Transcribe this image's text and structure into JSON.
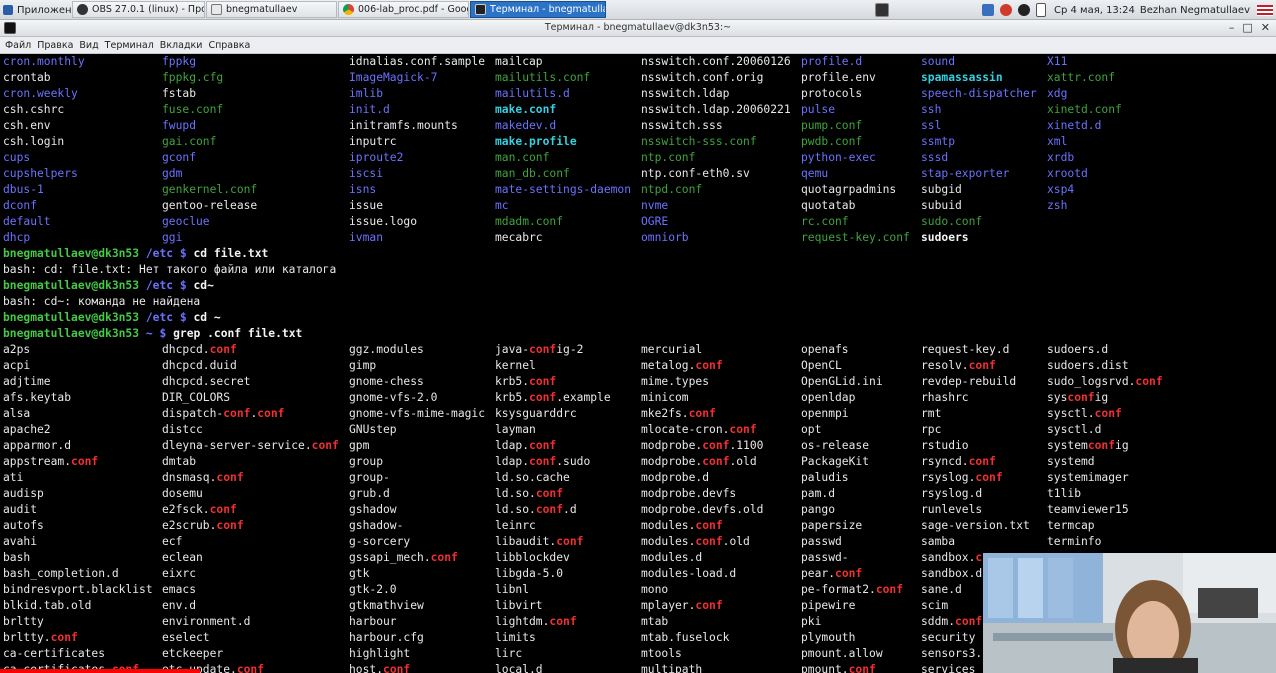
{
  "taskbar": {
    "apps_label": "Приложения",
    "tasks": [
      {
        "label": "OBS 27.0.1 (linux) - Проф..."
      },
      {
        "label": "bnegmatullaev"
      },
      {
        "label": "006-lab_proc.pdf - Google..."
      },
      {
        "label": "Терминал - bnegmatullaev..."
      }
    ],
    "clock": "Ср 4 мая, 13:24",
    "user": "Bezhan Negmatullaev"
  },
  "window": {
    "title": "Терминал - bnegmatullaev@dk3n53:~"
  },
  "menu": [
    "Файл",
    "Правка",
    "Вид",
    "Терминал",
    "Вкладки",
    "Справка"
  ],
  "colors": {
    "dir_blue": "#6b72ff",
    "exec_green": "#3fa43c",
    "prompt_green": "#45c945",
    "match_red": "#ef3030",
    "link_cyan": "#35d0e0"
  },
  "terminal": {
    "top_rows": [
      [
        [
          "cron.monthly",
          "blue"
        ],
        [
          "fppkg",
          "blue"
        ],
        [
          "idnalias.conf.sample",
          ""
        ],
        [
          "mailcap",
          ""
        ],
        [
          "nsswitch.conf.20060126",
          ""
        ],
        [
          "profile.d",
          "blue"
        ],
        [
          "sound",
          "blue"
        ],
        [
          "X11",
          "blue"
        ]
      ],
      [
        [
          "crontab",
          ""
        ],
        [
          "fppkg.cfg",
          "green"
        ],
        [
          "ImageMagick-7",
          "blue"
        ],
        [
          "mailutils.conf",
          "green"
        ],
        [
          "nsswitch.conf.orig",
          ""
        ],
        [
          "profile.env",
          ""
        ],
        [
          "spamassassin",
          "cyan"
        ],
        [
          "xattr.conf",
          "green"
        ]
      ],
      [
        [
          "cron.weekly",
          "blue"
        ],
        [
          "fstab",
          ""
        ],
        [
          "imlib",
          "blue"
        ],
        [
          "mailutils.d",
          "blue"
        ],
        [
          "nsswitch.ldap",
          ""
        ],
        [
          "protocols",
          ""
        ],
        [
          "speech-dispatcher",
          "blue"
        ],
        [
          "xdg",
          "blue"
        ]
      ],
      [
        [
          "csh.cshrc",
          ""
        ],
        [
          "fuse.conf",
          "green"
        ],
        [
          "init.d",
          "blue"
        ],
        [
          "make.conf",
          "cyan"
        ],
        [
          "nsswitch.ldap.20060221",
          ""
        ],
        [
          "pulse",
          "blue"
        ],
        [
          "ssh",
          "blue"
        ],
        [
          "xinetd.conf",
          "green"
        ]
      ],
      [
        [
          "csh.env",
          ""
        ],
        [
          "fwupd",
          "blue"
        ],
        [
          "initramfs.mounts",
          ""
        ],
        [
          "makedev.d",
          "blue"
        ],
        [
          "nsswitch.sss",
          ""
        ],
        [
          "pump.conf",
          "green"
        ],
        [
          "ssl",
          "blue"
        ],
        [
          "xinetd.d",
          "blue"
        ]
      ],
      [
        [
          "csh.login",
          ""
        ],
        [
          "gai.conf",
          "green"
        ],
        [
          "inputrc",
          ""
        ],
        [
          "make.profile",
          "cyan"
        ],
        [
          "nsswitch-sss.conf",
          "green"
        ],
        [
          "pwdb.conf",
          "green"
        ],
        [
          "ssmtp",
          "blue"
        ],
        [
          "xml",
          "blue"
        ]
      ],
      [
        [
          "cups",
          "blue"
        ],
        [
          "gconf",
          "blue"
        ],
        [
          "iproute2",
          "blue"
        ],
        [
          "man.conf",
          "green"
        ],
        [
          "ntp.conf",
          "green"
        ],
        [
          "python-exec",
          "blue"
        ],
        [
          "sssd",
          "blue"
        ],
        [
          "xrdb",
          "blue"
        ]
      ],
      [
        [
          "cupshelpers",
          "blue"
        ],
        [
          "gdm",
          "blue"
        ],
        [
          "iscsi",
          "blue"
        ],
        [
          "man_db.conf",
          "green"
        ],
        [
          "ntp.conf-eth0.sv",
          ""
        ],
        [
          "qemu",
          "blue"
        ],
        [
          "stap-exporter",
          "blue"
        ],
        [
          "xrootd",
          "blue"
        ]
      ],
      [
        [
          "dbus-1",
          "blue"
        ],
        [
          "genkernel.conf",
          "green"
        ],
        [
          "isns",
          "blue"
        ],
        [
          "mate-settings-daemon",
          "blue"
        ],
        [
          "ntpd.conf",
          "green"
        ],
        [
          "quotagrpadmins",
          ""
        ],
        [
          "subgid",
          ""
        ],
        [
          "xsp4",
          "blue"
        ]
      ],
      [
        [
          "dconf",
          "blue"
        ],
        [
          "gentoo-release",
          ""
        ],
        [
          "issue",
          ""
        ],
        [
          "mc",
          "blue"
        ],
        [
          "nvme",
          "blue"
        ],
        [
          "quotatab",
          ""
        ],
        [
          "subuid",
          ""
        ],
        [
          "zsh",
          "blue"
        ]
      ],
      [
        [
          "default",
          "blue"
        ],
        [
          "geoclue",
          "blue"
        ],
        [
          "issue.logo",
          ""
        ],
        [
          "mdadm.conf",
          "green"
        ],
        [
          "OGRE",
          "blue"
        ],
        [
          "rc.conf",
          "green"
        ],
        [
          "sudo.conf",
          "green"
        ],
        [
          "",
          ""
        ]
      ],
      [
        [
          "dhcp",
          "blue"
        ],
        [
          "ggi",
          "blue"
        ],
        [
          "ivman",
          "blue"
        ],
        [
          "mecabrc",
          ""
        ],
        [
          "omniorb",
          "blue"
        ],
        [
          "request-key.conf",
          "green"
        ],
        [
          "sudoers",
          "bold"
        ],
        [
          "",
          ""
        ]
      ]
    ],
    "session": [
      {
        "user": "bnegmatullaev@dk3n53",
        "path": "/etc",
        "cmd": "cd file.txt"
      },
      {
        "out": "bash: cd: file.txt: Нет такого файла или каталога"
      },
      {
        "user": "bnegmatullaev@dk3n53",
        "path": "/etc",
        "cmd": "cd~"
      },
      {
        "out": "bash: cd~: команда не найдена"
      },
      {
        "user": "bnegmatullaev@dk3n53",
        "path": "/etc",
        "cmd": "cd ~"
      },
      {
        "user": "bnegmatullaev@dk3n53",
        "path": "~",
        "cmd": "grep .conf file.txt"
      }
    ],
    "prompt_symbol": "$",
    "grep_rows": [
      [
        "a2ps",
        "dhcpcd.|conf|",
        "ggz.modules",
        "java-|conf|ig-2",
        "mercurial",
        "openafs",
        "request-key.d",
        "sudoers.d"
      ],
      [
        "acpi",
        "dhcpcd.duid",
        "gimp",
        "kernel",
        "metalog.|conf|",
        "OpenCL",
        "resolv.|conf|",
        "sudoers.dist"
      ],
      [
        "adjtime",
        "dhcpcd.secret",
        "gnome-chess",
        "krb5.|conf|",
        "mime.types",
        "OpenGLid.ini",
        "revdep-rebuild",
        "sudo_logsrvd.|conf|"
      ],
      [
        "afs.keytab",
        "DIR_COLORS",
        "gnome-vfs-2.0",
        "krb5.|conf|.example",
        "minicom",
        "openldap",
        "rhashrc",
        "sys|conf|ig"
      ],
      [
        "alsa",
        "dispatch-|conf|.|conf|",
        "gnome-vfs-mime-magic",
        "ksysguarddrc",
        "mke2fs.|conf|",
        "openmpi",
        "rmt",
        "sysctl.|conf|"
      ],
      [
        "apache2",
        "distcc",
        "GNUstep",
        "layman",
        "mlocate-cron.|conf|",
        "opt",
        "rpc",
        "sysctl.d"
      ],
      [
        "apparmor.d",
        "dleyna-server-service.|conf|",
        "gpm",
        "ldap.|conf|",
        "modprobe.|conf|.1100",
        "os-release",
        "rstudio",
        "system|conf|ig"
      ],
      [
        "appstream.|conf|",
        "dmtab",
        "group",
        "ldap.|conf|.sudo",
        "modprobe.|conf|.old",
        "PackageKit",
        "rsyncd.|conf|",
        "systemd"
      ],
      [
        "ati",
        "dnsmasq.|conf|",
        "group-",
        "ld.so.cache",
        "modprobe.d",
        "paludis",
        "rsyslog.|conf|",
        "systemimager"
      ],
      [
        "audisp",
        "dosemu",
        "grub.d",
        "ld.so.|conf|",
        "modprobe.devfs",
        "pam.d",
        "rsyslog.d",
        "t1lib"
      ],
      [
        "audit",
        "e2fsck.|conf|",
        "gshadow",
        "ld.so.|conf|.d",
        "modprobe.devfs.old",
        "pango",
        "runlevels",
        "teamviewer15"
      ],
      [
        "autofs",
        "e2scrub.|conf|",
        "gshadow-",
        "leinrc",
        "modules.|conf|",
        "papersize",
        "sage-version.txt",
        "termcap"
      ],
      [
        "avahi",
        "ecf",
        "g-sorcery",
        "libaudit.|conf|",
        "modules.|conf|.old",
        "passwd",
        "samba",
        "terminfo"
      ],
      [
        "bash",
        "eclean",
        "gssapi_mech.|conf|",
        "libblockdev",
        "modules.d",
        "passwd-",
        "sandbox.|c|",
        ""
      ],
      [
        "bash_completion.d",
        "eixrc",
        "gtk",
        "libgda-5.0",
        "modules-load.d",
        "pear.|conf|",
        "sandbox.d",
        ""
      ],
      [
        "bindresvport.blacklist",
        "emacs",
        "gtk-2.0",
        "libnl",
        "mono",
        "pe-format2.|conf|",
        "sane.d",
        ""
      ],
      [
        "blkid.tab.old",
        "env.d",
        "gtkmathview",
        "libvirt",
        "mplayer.|conf|",
        "pipewire",
        "scim",
        ""
      ],
      [
        "brltty",
        "environment.d",
        "harbour",
        "lightdm.|conf|",
        "mtab",
        "pki",
        "sddm.|conf|",
        ""
      ],
      [
        "brltty.|conf|",
        "eselect",
        "harbour.cfg",
        "limits",
        "mtab.fuselock",
        "plymouth",
        "security",
        ""
      ],
      [
        "ca-certificates",
        "etckeeper",
        "highlight",
        "lirc",
        "mtools",
        "pmount.allow",
        "sensors3.",
        ""
      ],
      [
        "ca-certificates.|conf|",
        "etc-update.|conf|",
        "host.|conf|",
        "local.d",
        "multipath",
        "pmount.|conf|",
        "services",
        ""
      ]
    ]
  }
}
